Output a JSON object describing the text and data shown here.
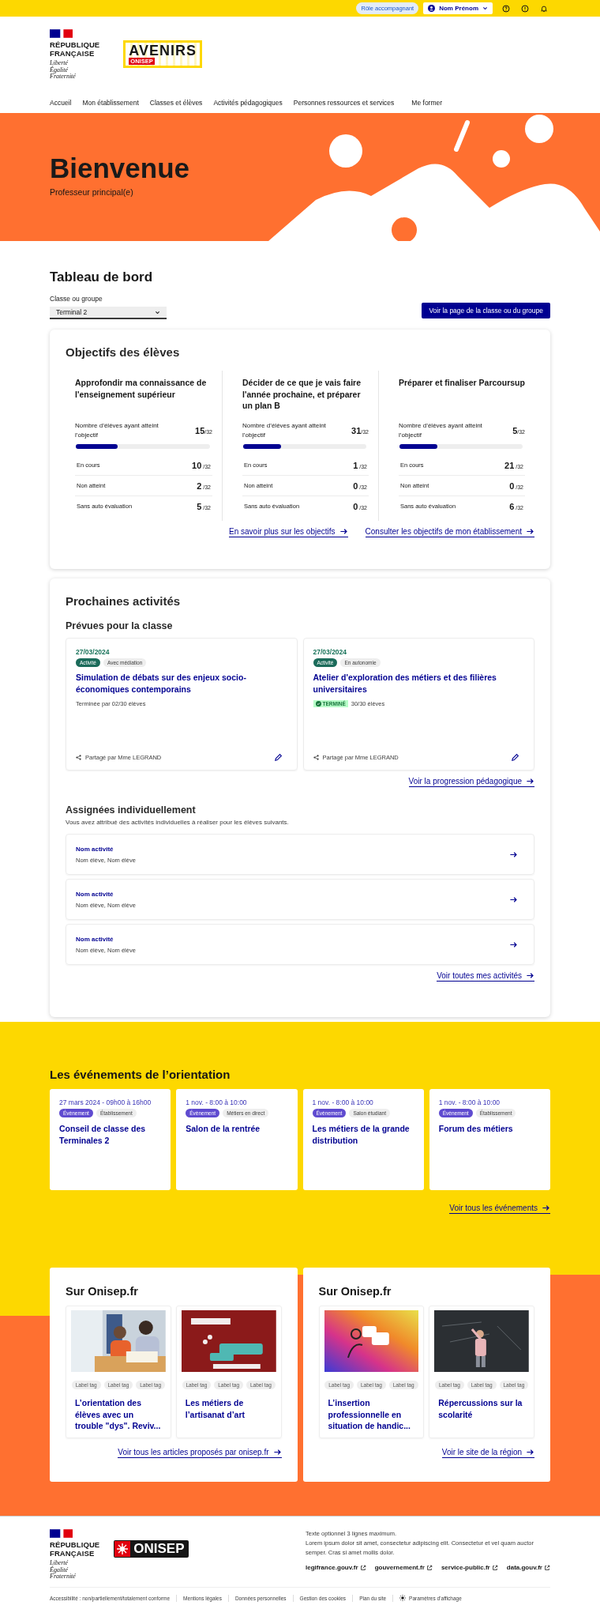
{
  "top_bar": {
    "role_badge": "Rôle accompagnant",
    "user_button": "Nom Prénom"
  },
  "header": {
    "republic_lines": [
      "RÉPUBLIQUE",
      "FRANÇAISE"
    ],
    "motto_lines": [
      "Liberté",
      "Égalité",
      "Fraternité"
    ],
    "logo_text": "AVENIRS",
    "logo_sub": "ONISEP"
  },
  "nav": [
    "Accueil",
    "Mon établissement",
    "Classes et élèves",
    "Activités pédagogiques",
    "Personnes ressources et services",
    "Me former"
  ],
  "hero": {
    "title": "Bienvenue",
    "subtitle": "Professeur principal(e)"
  },
  "dashboard": {
    "title": "Tableau de bord",
    "select_label": "Classe ou groupe",
    "select_value": "Terminal 2",
    "class_button": "Voir la page de la classe ou du groupe"
  },
  "objectives": {
    "title": "Objectifs des élèves",
    "items": [
      {
        "title": "Approfondir ma connaissance de l'enseignement supérieur",
        "reached_label": "Nombre d’élèves ayant atteint l’objectif",
        "reached": "15",
        "reached_total": "/32",
        "level": 0.31,
        "rows": [
          {
            "label": "En cours",
            "value": "10",
            "total": "/32"
          },
          {
            "label": "Non atteint",
            "value": "2",
            "total": "/32"
          },
          {
            "label": "Sans auto évaluation",
            "value": "5",
            "total": "/32"
          }
        ]
      },
      {
        "title": "Décider de ce que je vais faire l'année prochaine, et préparer un plan B",
        "reached_label": "Nombre d’élèves ayant atteint l’objectif",
        "reached": "31",
        "reached_total": "/32",
        "level": 0.31,
        "rows": [
          {
            "label": "En cours",
            "value": "1",
            "total": "/32"
          },
          {
            "label": "Non atteint",
            "value": "0",
            "total": "/32"
          },
          {
            "label": "Sans auto évaluation",
            "value": "0",
            "total": "/32"
          }
        ]
      },
      {
        "title": "Préparer et finaliser Parcoursup",
        "reached_label": "Nombre d’élèves ayant atteint l’objectif",
        "reached": "5",
        "reached_total": "/32",
        "level": 0.31,
        "rows": [
          {
            "label": "En cours",
            "value": "21",
            "total": "/32"
          },
          {
            "label": "Non atteint",
            "value": "0",
            "total": "/32"
          },
          {
            "label": "Sans auto évaluation",
            "value": "6",
            "total": "/32"
          }
        ]
      }
    ],
    "links": [
      "En savoir plus sur les objectifs",
      "Consulter les objectifs de mon établissement"
    ]
  },
  "activities": {
    "title": "Prochaines activités",
    "planned_title": "Prévues pour la classe",
    "planned": [
      {
        "date": "27/03/2024",
        "tags": [
          {
            "label": "Activité",
            "kind": "primary"
          },
          {
            "label": "Avec médiation",
            "kind": "neutral"
          }
        ],
        "title": "Simulation de débats sur des enjeux socio-économiques contemporains",
        "progress": "Terminée par 02/30 élèves",
        "shared": "Partagé par Mme LEGRAND"
      },
      {
        "date": "27/03/2024",
        "tags": [
          {
            "label": "Activité",
            "kind": "primary"
          },
          {
            "label": "En autonomie",
            "kind": "neutral"
          }
        ],
        "title": "Atelier d'exploration des métiers et des filières universitaires",
        "status_badge": "TERMINÉ",
        "progress": "30/30 élèves",
        "shared": "Partagé par Mme LEGRAND"
      }
    ],
    "progress_link": "Voir la progression pédagogique",
    "assigned_title": "Assignées individuellement",
    "assigned_intro": "Vous avez attribué des activités individuelles à réaliser pour les élèves suivants.",
    "assigned": [
      {
        "name": "Nom activité",
        "students": "Nom élève, Nom élève"
      },
      {
        "name": "Nom activité",
        "students": "Nom élève, Nom élève"
      },
      {
        "name": "Nom activité",
        "students": "Nom élève, Nom élève"
      }
    ],
    "all_link": "Voir toutes mes activités"
  },
  "events": {
    "title": "Les événements de l’orientation",
    "items": [
      {
        "date": "27 mars 2024 - 09h00 à 16h00",
        "tags": [
          {
            "label": "Évènement",
            "kind": "event"
          },
          {
            "label": "Établissement",
            "kind": "neutral"
          }
        ],
        "title": "Conseil de classe des Terminales 2"
      },
      {
        "date": "1 nov. - 8:00 à 10:00",
        "tags": [
          {
            "label": "Évènement",
            "kind": "event"
          },
          {
            "label": "Métiers en direct",
            "kind": "neutral"
          }
        ],
        "title": "Salon de la rentrée"
      },
      {
        "date": "1 nov. - 8:00 à 10:00",
        "tags": [
          {
            "label": "Évènement",
            "kind": "event"
          },
          {
            "label": "Salon étudiant",
            "kind": "neutral"
          }
        ],
        "title": "Les métiers de la grande distribution"
      },
      {
        "date": "1 nov. - 8:00 à 10:00",
        "tags": [
          {
            "label": "Évènement",
            "kind": "event"
          },
          {
            "label": "Établissement",
            "kind": "neutral"
          }
        ],
        "title": "Forum des métiers"
      }
    ],
    "link": "Voir tous les événements"
  },
  "onisep": [
    {
      "title": "Sur Onisep.fr",
      "articles": [
        {
          "tags": [
            "Label tag",
            "Label tag",
            "Label tag"
          ],
          "title": "L’orientation des élèves avec un trouble \"dys\". Reviv..."
        },
        {
          "tags": [
            "Label tag",
            "Label tag",
            "Label tag"
          ],
          "title": "Les métiers de l’artisanat d’art"
        }
      ],
      "link": "Voir tous les articles proposés par onisep.fr"
    },
    {
      "title": "Sur Onisep.fr",
      "articles": [
        {
          "tags": [
            "Label tag",
            "Label tag",
            "Label tag"
          ],
          "title": "L’insertion professionnelle en situation de handic..."
        },
        {
          "tags": [
            "Label tag",
            "Label tag",
            "Label tag"
          ],
          "title": "Répercussions sur la scolarité"
        }
      ],
      "link": "Voir le site de la région"
    }
  ],
  "footer": {
    "republic_lines": [
      "RÉPUBLIQUE",
      "FRANÇAISE"
    ],
    "motto_lines": [
      "Liberté",
      "Égalité",
      "Fraternité"
    ],
    "onisep_logo": "ONISEP",
    "text_lines": [
      "Texte optionnel 3 lignes maximum.",
      "Lorem ipsum dolor sit amet, consectetur adipiscing elit. Consectetur et vel quam auctor semper. Cras si amet mollis dolor."
    ],
    "links": [
      "legifrance.gouv.fr",
      "gouvernement.fr",
      "service-public.fr",
      "data.gouv.fr"
    ],
    "bottom_links": [
      {
        "label": "Accessibilité : non/partiellement/totalement conforme",
        "kind": "plain"
      },
      {
        "label": "Mentions légales",
        "kind": "plain"
      },
      {
        "label": "Données personnelles",
        "kind": "plain"
      },
      {
        "label": "Gestion des cookies",
        "kind": "plain"
      },
      {
        "label": "Plan du site",
        "kind": "plain"
      },
      {
        "label": "Paramètres d’affichage",
        "kind": "display"
      }
    ]
  }
}
